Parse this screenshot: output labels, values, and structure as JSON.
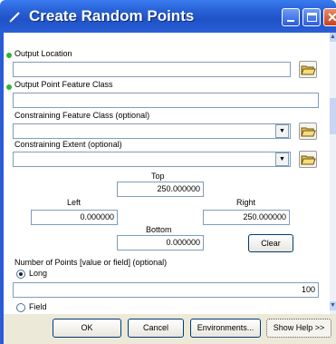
{
  "window": {
    "title": "Create Random Points",
    "colors": {
      "title_bar": "#2a63d8",
      "required_marker": "#2fb52f",
      "close_button": "#c8421c"
    }
  },
  "form": {
    "output_location": {
      "label": "Output Location",
      "value": ""
    },
    "output_point_feature_class": {
      "label": "Output Point Feature Class",
      "value": ""
    },
    "constraining_feature_class": {
      "label": "Constraining Feature Class (optional)",
      "value": ""
    },
    "constraining_extent": {
      "label": "Constraining Extent (optional)",
      "value": "",
      "top_label": "Top",
      "top_value": "250.000000",
      "left_label": "Left",
      "left_value": "0.000000",
      "right_label": "Right",
      "right_value": "250.000000",
      "bottom_label": "Bottom",
      "bottom_value": "0.000000",
      "clear_label": "Clear"
    },
    "number_of_points": {
      "label": "Number of Points [value or field] (optional)",
      "long_label": "Long",
      "long_selected": true,
      "value": "100",
      "field_label": "Field"
    }
  },
  "buttons": {
    "ok": "OK",
    "cancel": "Cancel",
    "environments": "Environments...",
    "show_help": "Show Help >>"
  },
  "icons": {
    "title": "pencil-icon",
    "folder": "open-folder-icon",
    "dropdown": "chevron-down-icon",
    "scroll_up": "scroll-up-arrow-icon",
    "scroll_down": "scroll-down-arrow-icon"
  }
}
